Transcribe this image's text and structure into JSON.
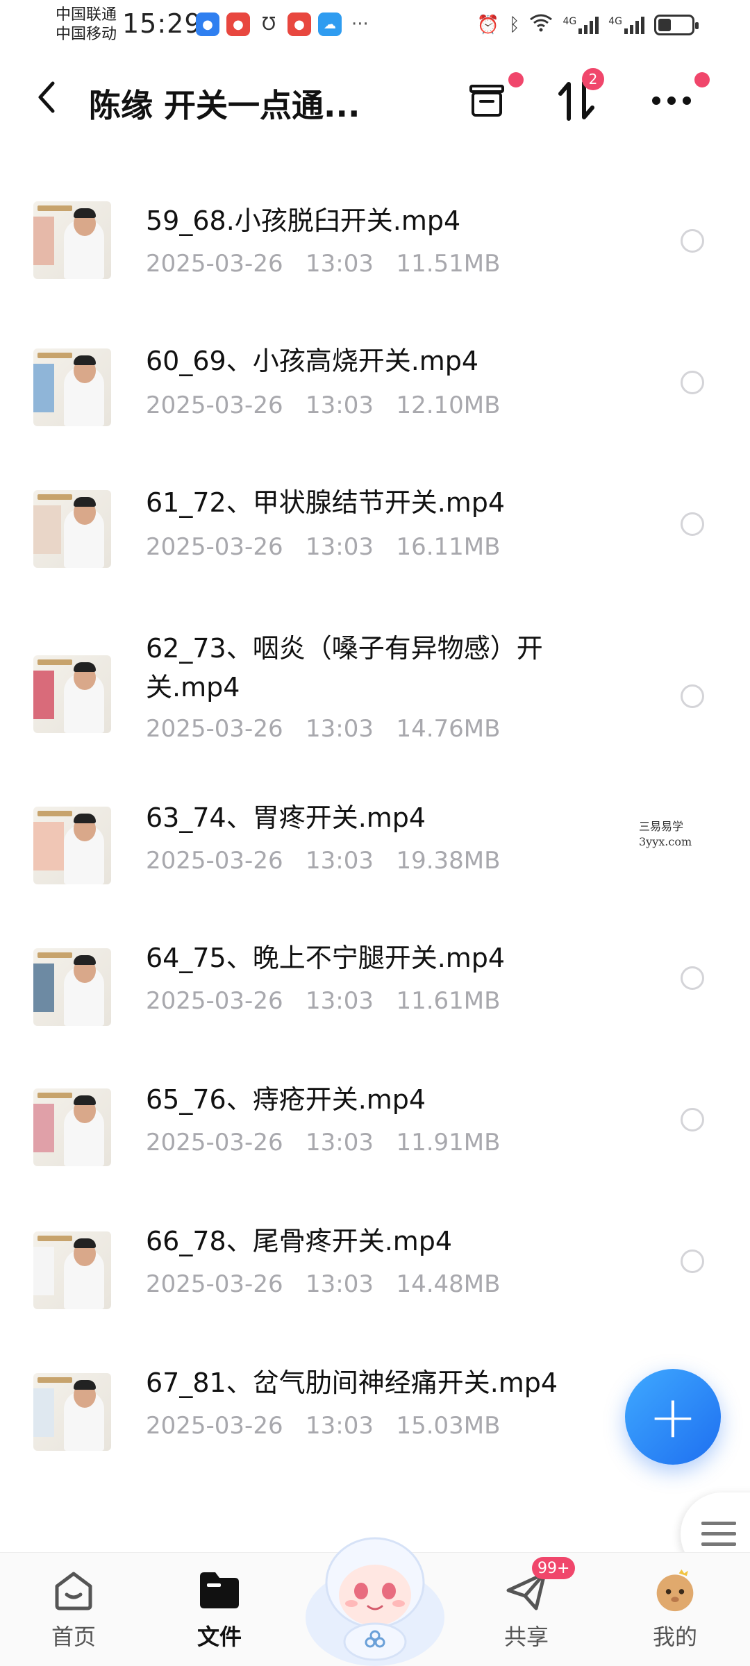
{
  "status_bar": {
    "carrier_1": "中国联通",
    "carrier_2": "中国移动",
    "time": "15:29",
    "more": "···",
    "network_1": "4G",
    "network_2": "4G"
  },
  "header": {
    "title": "陈缘 开关一点通...",
    "transfer_badge": "2"
  },
  "files": [
    {
      "name": "59_68.小孩脱臼开关.mp4",
      "date": "2025-03-26",
      "time": "13:03",
      "size": "11.51MB"
    },
    {
      "name": "60_69、小孩高烧开关.mp4",
      "date": "2025-03-26",
      "time": "13:03",
      "size": "12.10MB"
    },
    {
      "name": "61_72、甲状腺结节开关.mp4",
      "date": "2025-03-26",
      "time": "13:03",
      "size": "16.11MB"
    },
    {
      "name": "62_73、咽炎（嗓子有异物感）开关.mp4",
      "date": "2025-03-26",
      "time": "13:03",
      "size": "14.76MB"
    },
    {
      "name": "63_74、胃疼开关.mp4",
      "date": "2025-03-26",
      "time": "13:03",
      "size": "19.38MB"
    },
    {
      "name": "64_75、晚上不宁腿开关.mp4",
      "date": "2025-03-26",
      "time": "13:03",
      "size": "11.61MB"
    },
    {
      "name": "65_76、痔疮开关.mp4",
      "date": "2025-03-26",
      "time": "13:03",
      "size": "11.91MB"
    },
    {
      "name": "66_78、尾骨疼开关.mp4",
      "date": "2025-03-26",
      "time": "13:03",
      "size": "14.48MB"
    },
    {
      "name": "67_81、岔气肋间神经痛开关.mp4",
      "date": "2025-03-26",
      "time": "13:03",
      "size": "15.03MB"
    }
  ],
  "watermark": {
    "line1": "三易易学",
    "line2": "3yyx.com"
  },
  "fab": {
    "icon": "plus-icon",
    "label": "+"
  },
  "bottom_nav": {
    "home": "首页",
    "files": "文件",
    "share": "共享",
    "share_badge": "99+",
    "mine": "我的"
  },
  "colors": {
    "accent": "#1e6ff0",
    "badge": "#f0466b",
    "meta_text": "#a8a8ad"
  }
}
